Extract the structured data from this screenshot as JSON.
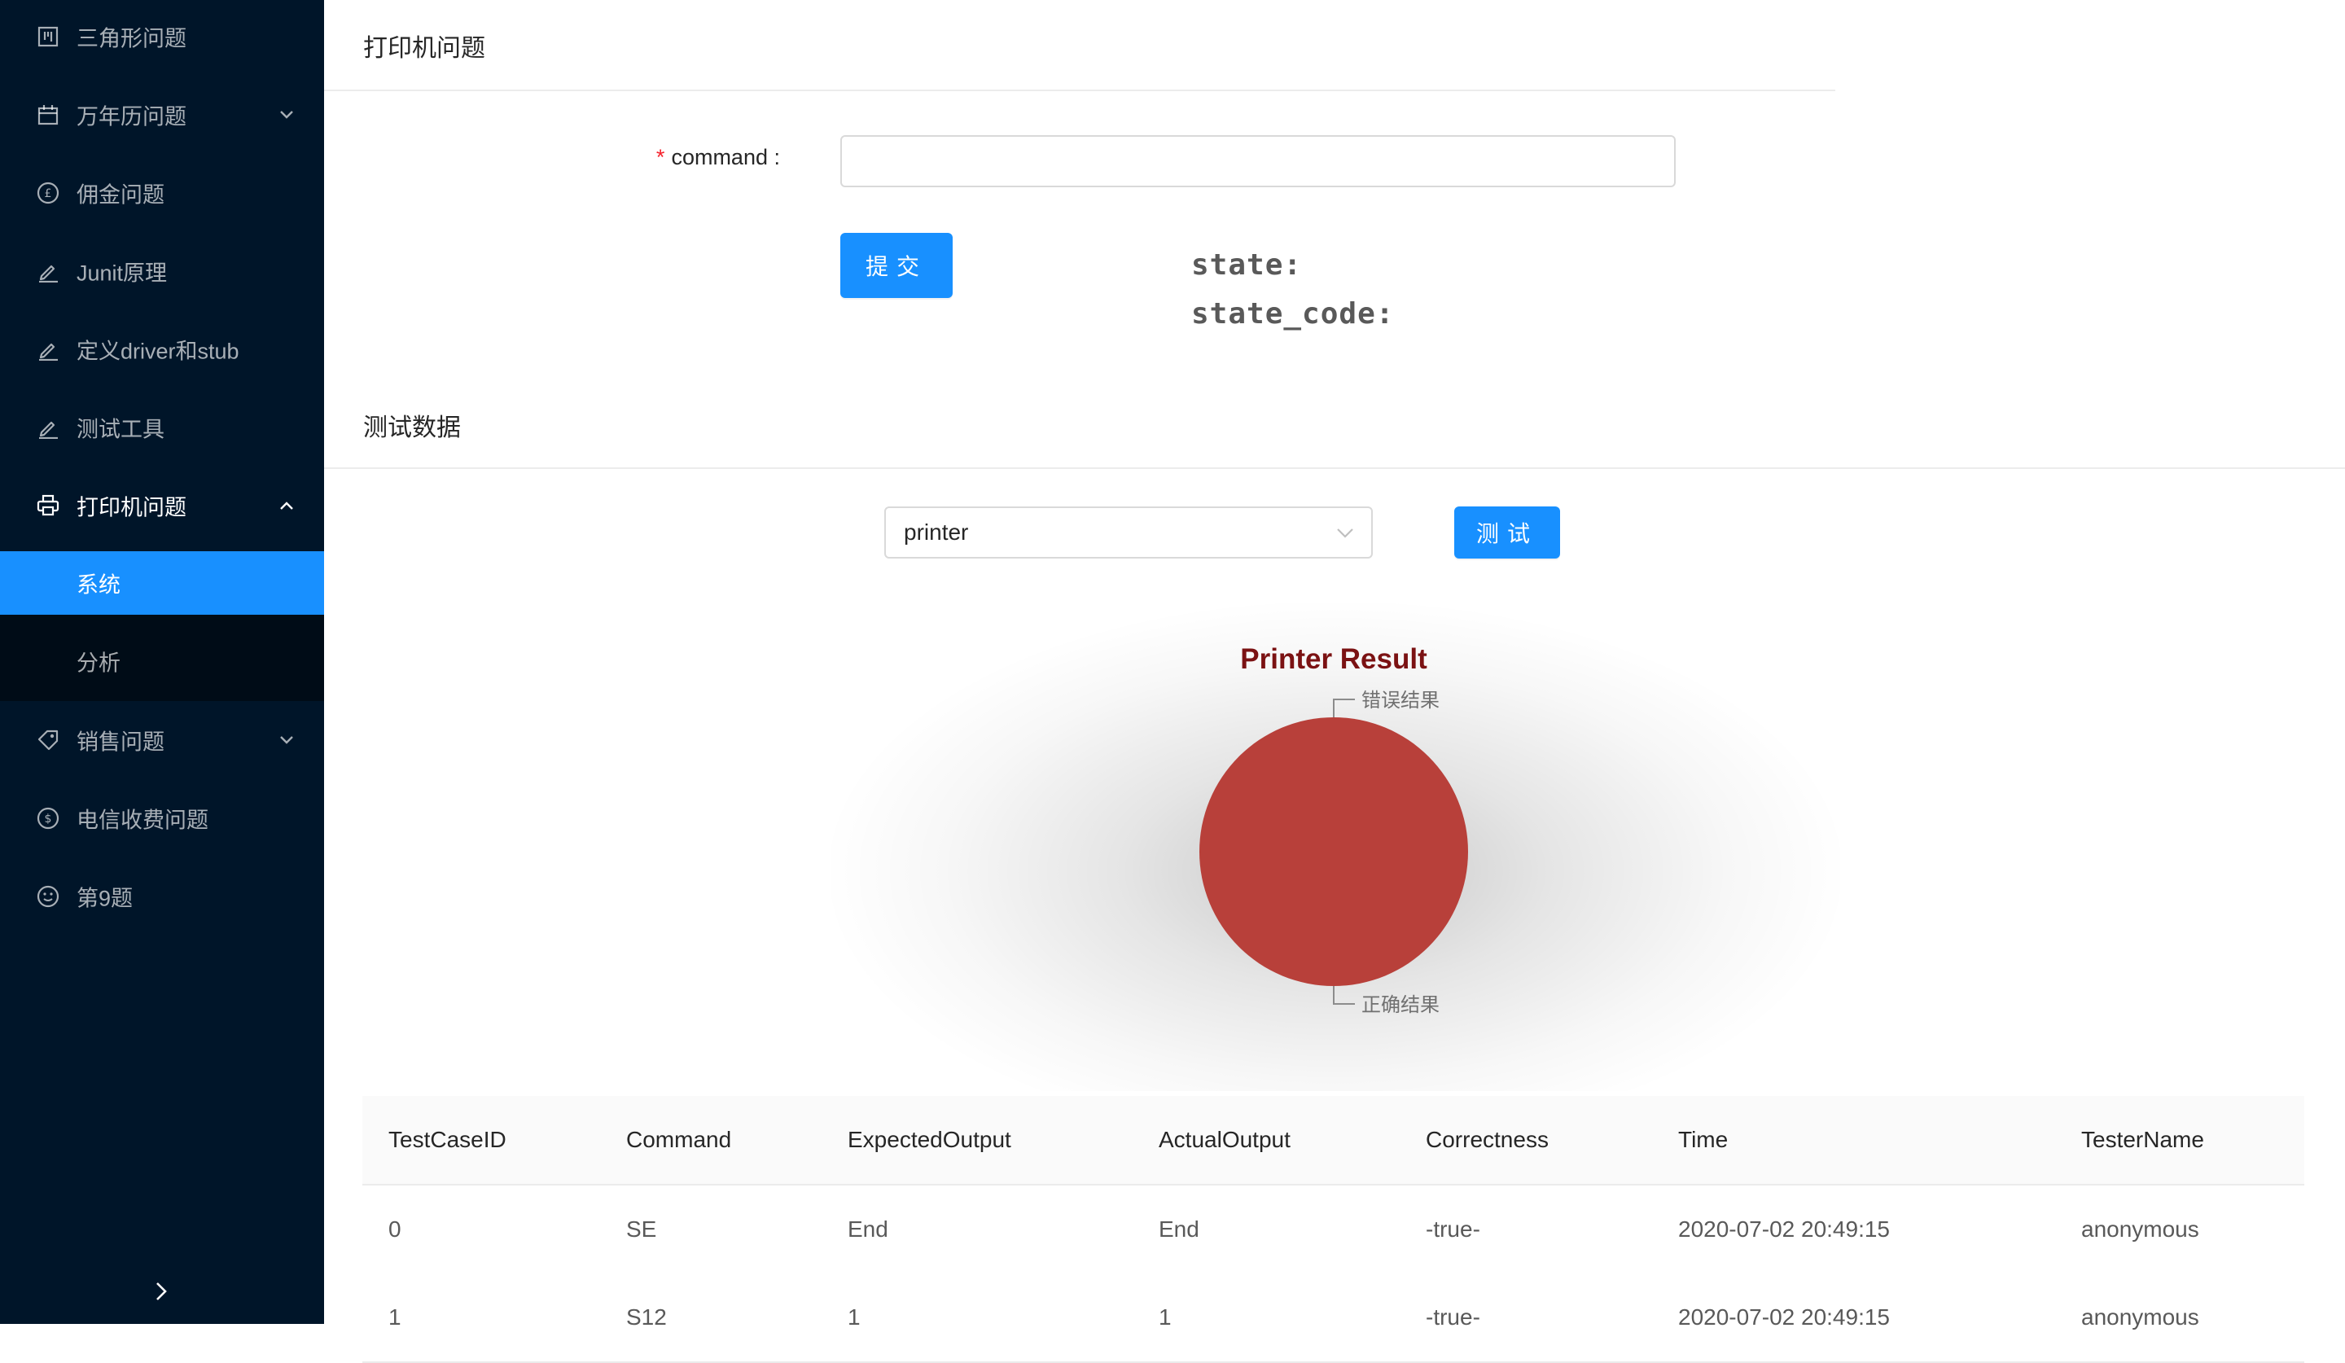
{
  "sidebar": {
    "items": [
      {
        "label": "三角形问题",
        "icon": "project-icon"
      },
      {
        "label": "万年历问题",
        "icon": "calendar-icon"
      },
      {
        "label": "佣金问题",
        "icon": "pound-icon"
      },
      {
        "label": "Junit原理",
        "icon": "edit-icon"
      },
      {
        "label": "定义driver和stub",
        "icon": "edit-icon"
      },
      {
        "label": "测试工具",
        "icon": "edit-icon"
      },
      {
        "label": "打印机问题",
        "icon": "printer-icon"
      },
      {
        "label": "销售问题",
        "icon": "tag-icon"
      },
      {
        "label": "电信收费问题",
        "icon": "dollar-icon"
      },
      {
        "label": "第9题",
        "icon": "smile-icon"
      }
    ],
    "submenu": [
      {
        "label": "系统",
        "selected": true
      },
      {
        "label": "分析",
        "selected": false
      }
    ]
  },
  "form_card": {
    "title": "打印机问题",
    "command_label": "command",
    "command_value": "",
    "submit_label": "提交",
    "state_label": "state:",
    "state_code_label": "state_code:"
  },
  "test_card": {
    "title": "测试数据",
    "select_value": "printer",
    "test_button_label": "测试"
  },
  "chart_data": {
    "type": "pie",
    "title": "Printer Result",
    "slices": [
      {
        "label": "错误结果",
        "value": 0
      },
      {
        "label": "正确结果",
        "value": 100
      }
    ],
    "colors": [
      "#c23531",
      "#b8403a"
    ]
  },
  "table": {
    "columns": [
      "TestCaseID",
      "Command",
      "ExpectedOutput",
      "ActualOutput",
      "Correctness",
      "Time",
      "TesterName"
    ],
    "rows": [
      [
        "0",
        "SE",
        "End",
        "End",
        "-true-",
        "2020-07-02 20:49:15",
        "anonymous"
      ],
      [
        "1",
        "S12",
        "1",
        "1",
        "-true-",
        "2020-07-02 20:49:15",
        "anonymous"
      ]
    ]
  },
  "colors": {
    "sidebar_bg": "#001529",
    "primary": "#1890ff",
    "pie": "#b8403a",
    "chart_title": "#7b1213"
  }
}
